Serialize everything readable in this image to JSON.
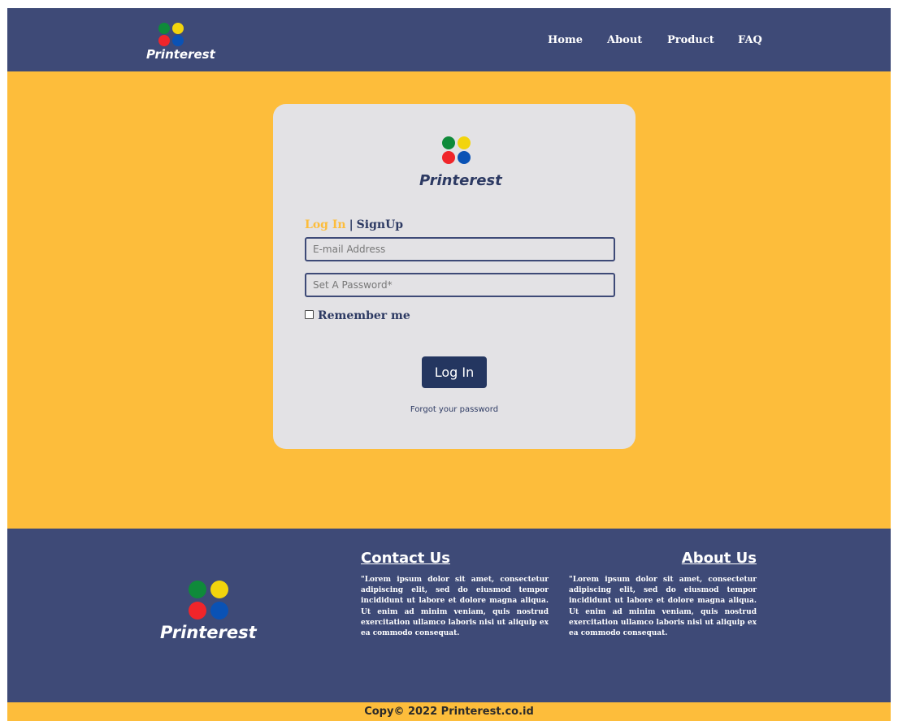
{
  "brand": {
    "name": "Printerest",
    "dot_colors": [
      "#0f8a3a",
      "#f2d40d",
      "#f0252a",
      "#0a52b5"
    ]
  },
  "colors": {
    "navy": "#3e4a77",
    "accent": "#fdbd3b",
    "card": "#e3e2e5",
    "button": "#243660"
  },
  "nav": {
    "items": [
      {
        "label": "Home"
      },
      {
        "label": "About"
      },
      {
        "label": "Product"
      },
      {
        "label": "FAQ"
      }
    ]
  },
  "login": {
    "tab_login": "Log In",
    "tab_separator": "|",
    "tab_signup": "SignUp",
    "email_placeholder": "E-mail Address",
    "email_value": "",
    "password_placeholder": "Set A Password*",
    "password_value": "",
    "remember_label": "Remember me",
    "remember_checked": false,
    "submit_label": "Log In",
    "forgot_label": "Forgot your password"
  },
  "footer": {
    "contact_title": "Contact Us",
    "contact_text": "\"Lorem ipsum dolor sit amet, consectetur adipiscing elit, sed do eiusmod tempor incididunt ut labore et dolore magna aliqua. Ut enim ad minim veniam, quis nostrud exercitation ullamco laboris nisi ut aliquip ex ea commodo consequat.",
    "about_title": "About Us",
    "about_text": "\"Lorem ipsum dolor sit amet, consectetur adipiscing elit, sed do eiusmod tempor incididunt ut labore et dolore magna aliqua. Ut enim ad minim veniam, quis nostrud exercitation ullamco laboris nisi ut aliquip ex ea commodo consequat.",
    "copyright": "Copy© 2022 Printerest.co.id"
  }
}
